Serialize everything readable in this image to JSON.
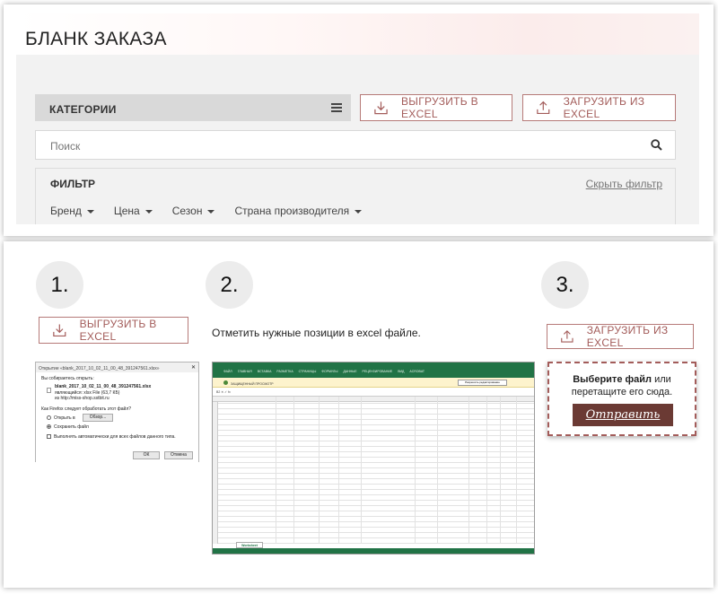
{
  "header": {
    "title": "БЛАНК ЗАКАЗА"
  },
  "toolbar": {
    "categories_label": "КАТЕГОРИИ",
    "export_label": "ВЫГРУЗИТЬ В EXCEL",
    "import_label": "ЗАГРУЗИТЬ ИЗ EXCEL"
  },
  "search": {
    "placeholder": "Поиск"
  },
  "filter": {
    "title": "ФИЛЬТР",
    "hide_label": "Скрыть фильтр",
    "items": [
      "Бренд",
      "Цена",
      "Сезон",
      "Страна производителя"
    ]
  },
  "steps": {
    "step1": "1.",
    "step2": "2.",
    "step3": "3.",
    "export_label": "ВЫГРУЗИТЬ В EXCEL",
    "instruction": "Отметить нужные позиции в excel файле.",
    "import_label": "ЗАГРУЗИТЬ ИЗ EXCEL"
  },
  "download_dialog": {
    "title": "Открытие «blank_2017_10_02_11_00_48_391247561.xlsx»",
    "opening": "Вы собираетесь открыть:",
    "filename": "blank_2017_10_02_11_00_48_391247561.xlsx",
    "filetype": "являющийся: xlsx File (63,7 КБ)",
    "from": "из http://miss-shop.sstbit.ru",
    "question": "Как Firefox следует обработать этот файл?",
    "open_with": "Открыть в",
    "browse": "Обзор...",
    "save_file": "Сохранить файл",
    "auto": "Выполнять автоматически для всех файлов данного типа.",
    "ok": "ОК",
    "cancel": "Отмена"
  },
  "excel": {
    "tabs": "ФАЙЛ ГЛАВНАЯ ВСТАВКА РАЗМЕТКА СТРАНИЦЫ ФОРМУЛЫ ДАННЫЕ РЕЦЕНЗИРОВАНИЕ ВИД ACROBAT",
    "warning": "ЗАЩИЩЕННЫЙ ПРОСМОТР",
    "enable_editing": "Разрешить редактирование",
    "sheet": "Worksheet"
  },
  "dropzone": {
    "line1_bold": "Выберите файл",
    "line1_rest": "или",
    "line2": "перетащите его сюда.",
    "submit": "Отправить"
  },
  "colors": {
    "accent": "#a35c5a",
    "submit_bg": "#6b3a34",
    "excel_green": "#217346"
  }
}
